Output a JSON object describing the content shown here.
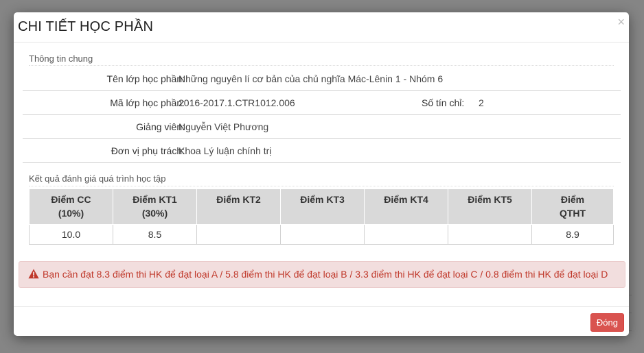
{
  "modal": {
    "title": "CHI TIẾT HỌC PHẦN",
    "close_symbol": "×",
    "general_section_title": "Thông tin chung",
    "info": {
      "class_name_label": "Tên lớp học phần:",
      "class_name_value": "Những nguyên lí cơ bản của chủ nghĩa Mác-Lênin 1 - Nhóm 6",
      "class_code_label": "Mã lớp học phần:",
      "class_code_value": "2016-2017.1.CTR1012.006",
      "credits_label": "Số tín chỉ:",
      "credits_value": "2",
      "lecturer_label": "Giảng viên:",
      "lecturer_value": "Nguyễn Việt Phương",
      "department_label": "Đơn vị phụ trách:",
      "department_value": "Khoa Lý luận chính trị"
    },
    "results_section_title": "Kết quả đánh giá quá trình học tập",
    "grades_table": {
      "headers": [
        {
          "line1": "Điểm CC",
          "line2": "(10%)"
        },
        {
          "line1": "Điểm KT1",
          "line2": "(30%)"
        },
        {
          "line1": "Điểm KT2",
          "line2": ""
        },
        {
          "line1": "Điểm KT3",
          "line2": ""
        },
        {
          "line1": "Điểm KT4",
          "line2": ""
        },
        {
          "line1": "Điểm KT5",
          "line2": ""
        },
        {
          "line1": "Điểm",
          "line2": "QTHT"
        }
      ],
      "values": [
        "10.0",
        "8.5",
        "",
        "",
        "",
        "",
        "8.9"
      ]
    },
    "alert": {
      "icon": "warning-triangle-icon",
      "text": "Bạn cần đạt 8.3 điểm thi HK để đạt loại A / 5.8 điểm thi HK để đạt loại B / 3.3 điểm thi HK để đạt loại C / 0.8 điểm thi HK để đạt loại D"
    },
    "footer": {
      "close_button_label": "Đóng"
    }
  },
  "colors": {
    "alert_bg": "#f2dede",
    "alert_text": "#c0392b",
    "button_danger": "#d9534f",
    "table_header_bg": "#d9d9d9"
  }
}
